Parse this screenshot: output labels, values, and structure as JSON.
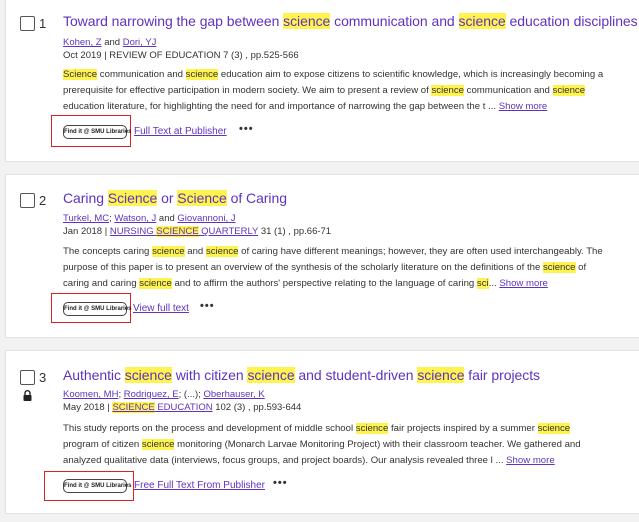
{
  "results": [
    {
      "number": "1",
      "title_parts": [
        "Toward narrowing the gap between ",
        "science",
        " communication and ",
        "science",
        " education disciplines"
      ],
      "authors": [
        "Kohen, Z",
        " and ",
        "Dori, YJ"
      ],
      "meta": "Oct 2019 | REVIEW OF EDUCATION 7 (3) , pp.525-566",
      "abstract_lines": [
        [
          "",
          "Science",
          " communication and ",
          "science",
          " education aim to expose citizens to scientific knowledge, which is increasingly becoming a"
        ],
        [
          "prerequisite for effective participation in modern society. We aim to present a review of ",
          "science",
          " communication and ",
          "science",
          ""
        ],
        [
          "education literature, for highlighting the need for and importance of narrowing the gap between the t ...",
          "",
          "",
          "",
          ""
        ]
      ],
      "show_more": "Show more",
      "findit_label": "Find it @ SMU Libraries",
      "action_link": "Full Text at Publisher",
      "more_menu": "•••"
    },
    {
      "number": "2",
      "title_parts": [
        "Caring ",
        "Science",
        " or ",
        "Science",
        " of Caring"
      ],
      "authors": [
        "Turkel, MC",
        "; ",
        "Watson, J",
        " and ",
        "Giovannoni, J"
      ],
      "meta_prefix": "Jan 2018 | ",
      "meta_journal_parts": [
        "NURSING ",
        "SCIENCE",
        " QUARTERLY"
      ],
      "meta_suffix": " 31 (1) , pp.66-71",
      "abstract_lines": [
        [
          "The concepts caring ",
          "science",
          " and ",
          "science",
          " of caring have different meanings; however, they are often used interchangeably. The"
        ],
        [
          "purpose of this paper is to present an overview of the synthesis of the scholarly literature on the definitions of the ",
          "science",
          " of",
          "",
          ""
        ],
        [
          "caring and caring ",
          "science",
          " and to affirm the authors' perspective relating to the language of caring ",
          "sci",
          "..."
        ]
      ],
      "show_more": "Show more",
      "findit_label": "Find it @ SMU Libraries",
      "action_link": "View full text",
      "more_menu": "•••"
    },
    {
      "number": "3",
      "title_parts": [
        "Authentic ",
        "science",
        " with citizen ",
        "science",
        " and student-driven ",
        "science",
        " fair projects"
      ],
      "authors": [
        "Koomen, MH",
        "; ",
        "Rodriguez, E",
        "; (...); ",
        "Oberhauser, K"
      ],
      "meta_prefix": "May 2018 | ",
      "meta_journal_parts": [
        "SCIENCE",
        " EDUCATION"
      ],
      "meta_suffix": " 102 (3) , pp.593-644",
      "abstract_lines": [
        [
          "This study reports on the process and development of middle school ",
          "science",
          " fair projects inspired by a summer ",
          "science",
          ""
        ],
        [
          "program of citizen ",
          "science",
          " monitoring (Monarch Larvae Monitoring Project) with their classroom teacher. We gathered and",
          "",
          ""
        ],
        [
          "analyzed qualitative data (interviews, focus groups, and project boards). Our analysis revealed three l ...",
          "",
          "",
          "",
          ""
        ]
      ],
      "show_more": "Show more",
      "findit_label": "Find it @ SMU Libraries",
      "action_link": "Free Full Text From Publisher",
      "more_menu": "•••",
      "lock_icon": "lock-icon"
    }
  ],
  "colors": {
    "link": "#5e33bf",
    "highlight": "#fff34f",
    "annotation": "#e02020"
  }
}
